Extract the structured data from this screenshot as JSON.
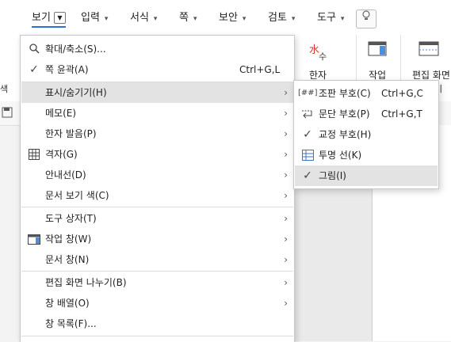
{
  "menubar": {
    "items": [
      {
        "label": "보기",
        "active": true
      },
      {
        "label": "입력"
      },
      {
        "label": "서식"
      },
      {
        "label": "쪽"
      },
      {
        "label": "보안"
      },
      {
        "label": "검토"
      },
      {
        "label": "도구"
      }
    ],
    "help_icon": "lightbulb-icon"
  },
  "ribbon": {
    "hanja_label": "한자",
    "task_label": "작업",
    "split_label": "편집 화면",
    "partial_left": "색",
    "partial_right": "기"
  },
  "view_menu": {
    "items": [
      {
        "label": "확대/축소(S)...",
        "icon": "zoom-icon"
      },
      {
        "label": "쪽 윤곽(A)",
        "shortcut": "Ctrl+G,L",
        "checked": true
      },
      {
        "label": "표시/숨기기(H)",
        "submenu": true,
        "highlighted": true
      },
      {
        "label": "메모(E)",
        "submenu": true
      },
      {
        "label": "한자 발음(P)",
        "submenu": true
      },
      {
        "label": "격자(G)",
        "submenu": true,
        "icon": "grid-icon"
      },
      {
        "label": "안내선(D)",
        "submenu": true
      },
      {
        "label": "문서 보기 색(C)",
        "submenu": true
      },
      {
        "label": "도구 상자(T)",
        "submenu": true
      },
      {
        "label": "작업 창(W)",
        "submenu": true,
        "icon": "task-pane-icon"
      },
      {
        "label": "문서 창(N)",
        "submenu": true
      },
      {
        "label": "편집 화면 나누기(B)",
        "submenu": true
      },
      {
        "label": "창 배열(O)",
        "submenu": true
      },
      {
        "label": "창 목록(F)..."
      }
    ]
  },
  "show_hide_submenu": {
    "items": [
      {
        "label": "조판 부호(C)",
        "shortcut": "Ctrl+G,C",
        "icon_text": "[##]"
      },
      {
        "label": "문단 부호(P)",
        "shortcut": "Ctrl+G,T",
        "icon": "paragraph-mark-icon"
      },
      {
        "label": "교정 부호(H)",
        "checked": true
      },
      {
        "label": "투명 선(K)",
        "icon": "transparent-line-icon"
      },
      {
        "label": "그림(I)",
        "checked": true,
        "highlighted": true
      }
    ]
  },
  "colors": {
    "accent": "#2b6fd6",
    "highlight": "#e3e3e3"
  }
}
